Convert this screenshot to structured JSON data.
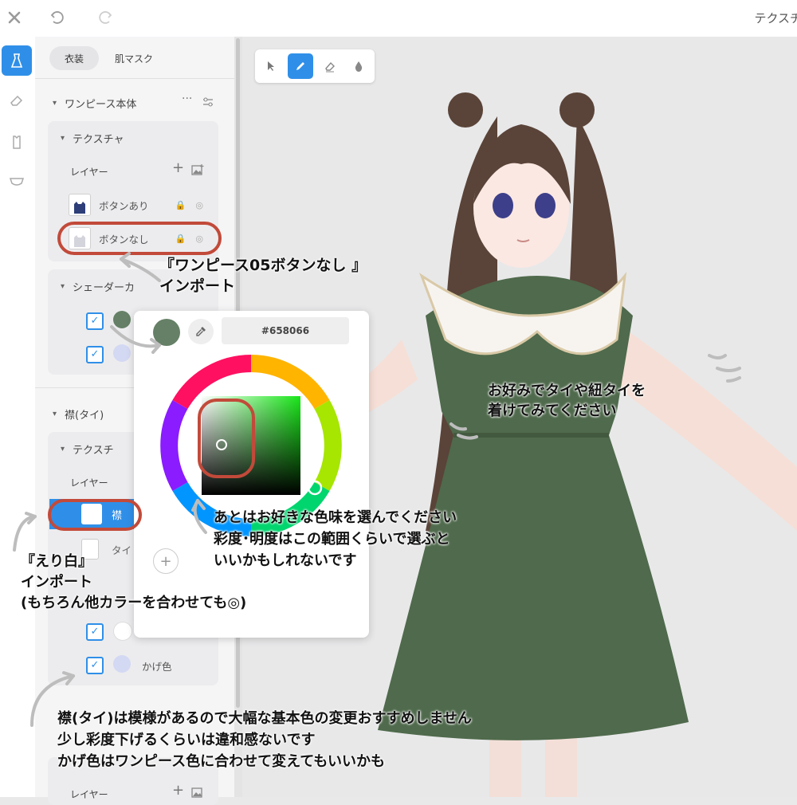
{
  "toolbar": {
    "close_icon": "close-icon",
    "undo_icon": "undo-icon",
    "redo_icon": "redo-icon",
    "window_title": "テクスチ"
  },
  "rail": {
    "items": [
      "dress-icon",
      "eraser-icon",
      "shirt-icon",
      "shorts-icon"
    ]
  },
  "panel": {
    "tabs": [
      {
        "label": "衣装",
        "active": true
      },
      {
        "label": "肌マスク",
        "active": false
      }
    ],
    "section1": {
      "title": "ワンピース本体",
      "more": "···",
      "texture_title": "テクスチャ",
      "layers_label": "レイヤー",
      "add": "+",
      "layers": [
        {
          "name": "ボタンあり"
        },
        {
          "name": "ボタンなし"
        }
      ],
      "shader_title": "シェーダーカ"
    },
    "section2": {
      "title": "襟(タイ)",
      "texture_title": "テクスチ",
      "layers_label": "レイヤー",
      "layers": [
        {
          "name": "襟"
        },
        {
          "name": "タイ"
        }
      ],
      "shadow_label": "かげ色"
    },
    "section3": {
      "layers_label": "レイヤー",
      "add": "+"
    }
  },
  "picker": {
    "hex": "#658066",
    "current_color": "#658066",
    "eyedropper_icon": "eyedropper-icon"
  },
  "tools": [
    "cursor-icon",
    "pen-icon",
    "eraser-icon",
    "fill-drop-icon"
  ],
  "notes": {
    "import_button_less": "『ワンピース05ボタンなし 』\nインポート",
    "tie_suggestion": "お好みでタイや紐タイを\n着けてみてください",
    "choose_color": "あとはお好きな色味を選んでください\n彩度･明度はこの範囲くらいで選ぶと\nいいかもしれないです",
    "collar_white": "『えり白』\nインポート\n(もちろん他カラーを合わせても◎)",
    "collar_advice": "襟(タイ)は模様があるので大幅な基本色の変更おすすめしません\n少し彩度下げるくらいは違和感ないです\nかげ色はワンピース色に合わせて変えてもいいかも"
  },
  "colors": {
    "accent": "#2f8fe8",
    "dress_green": "#4f6a4c",
    "annotation_red": "#c24a3a",
    "swatch_green": "#658066",
    "swatch_lavender": "#d3d8f3"
  }
}
